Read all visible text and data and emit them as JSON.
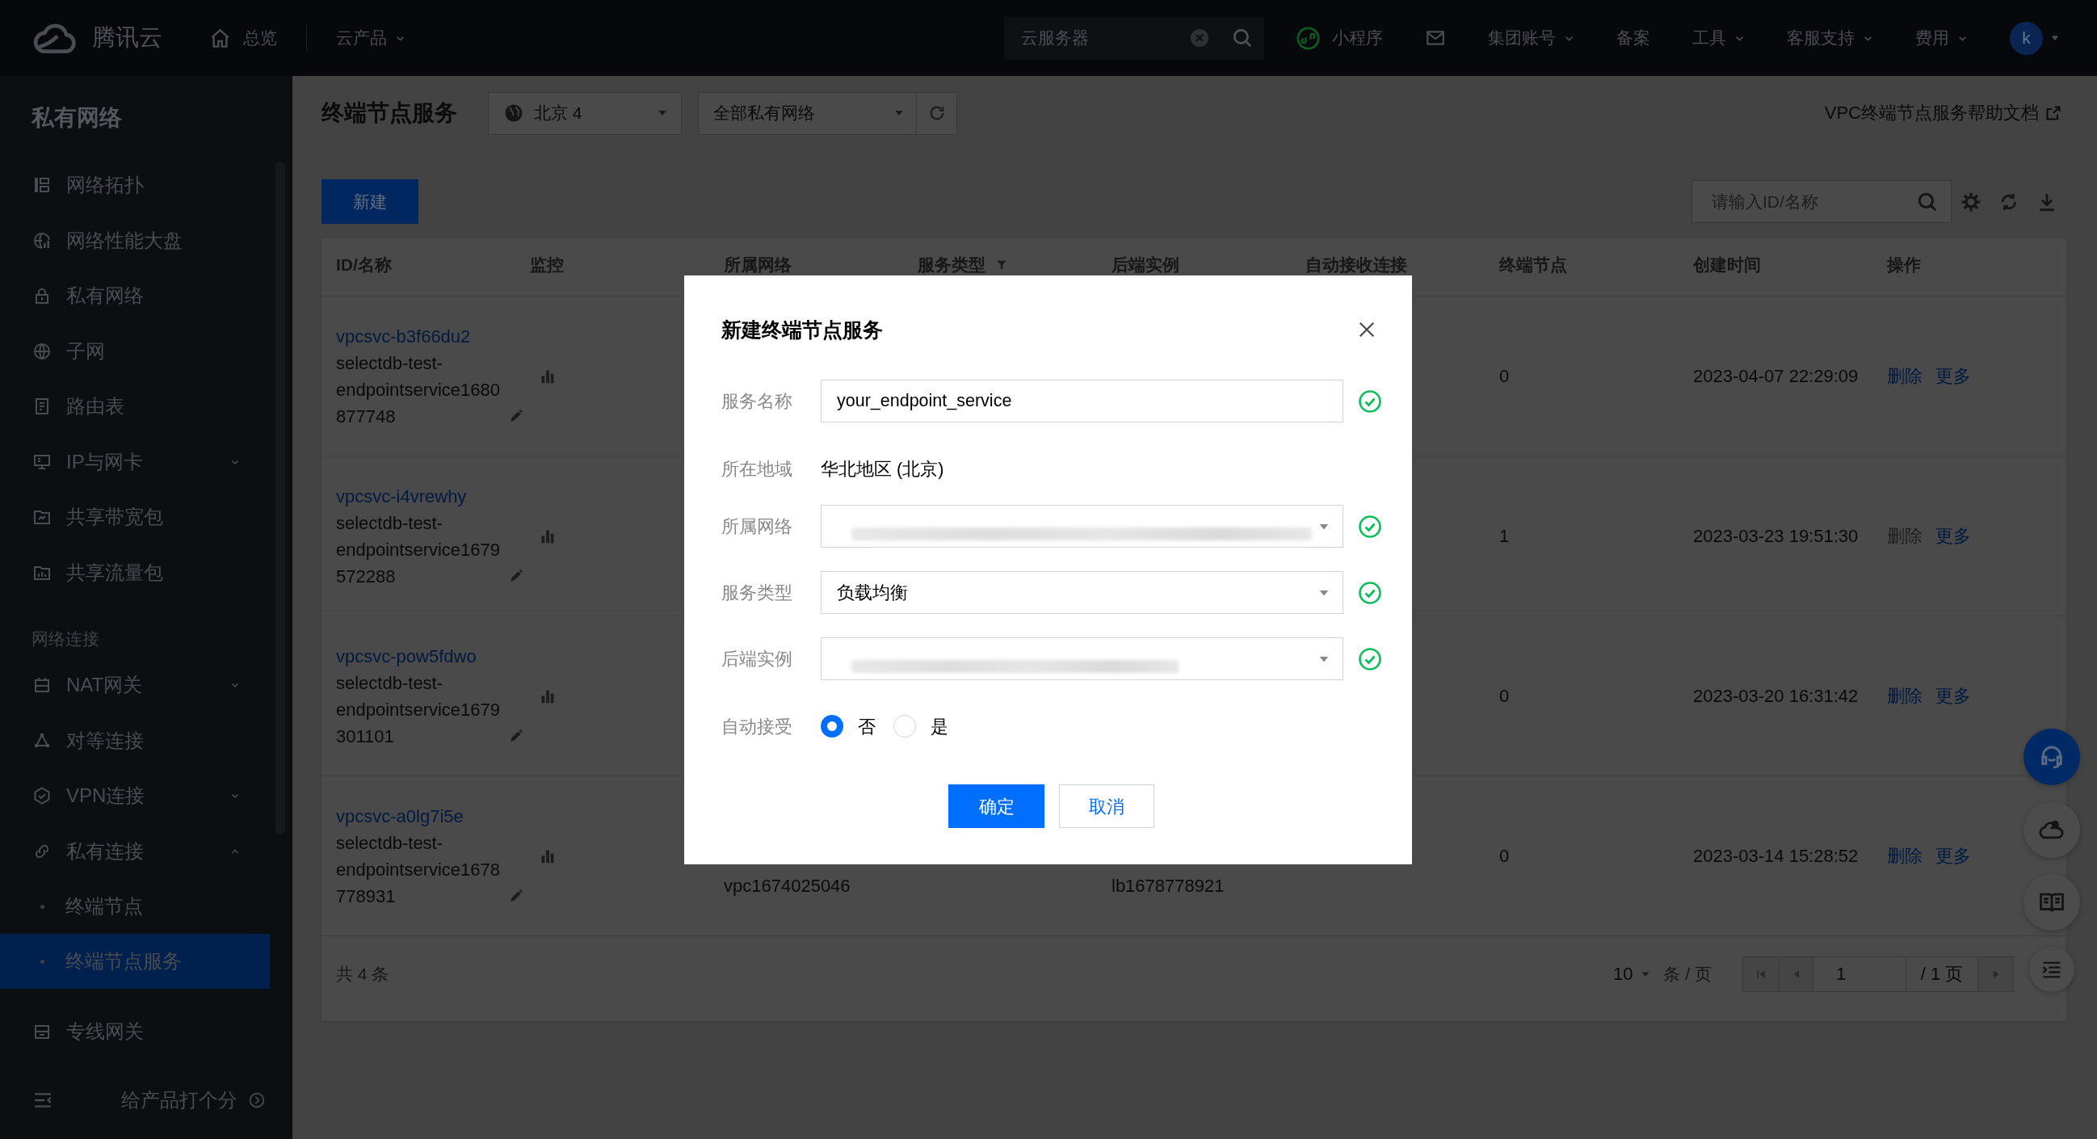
{
  "top_bar": {
    "logo": "腾讯云",
    "nav": [
      {
        "kind": "home",
        "label": "总览"
      },
      {
        "kind": "menu",
        "label": "云产品"
      }
    ],
    "search": {
      "placeholder": "云服务器"
    },
    "links": [
      {
        "kind": "mini_program",
        "label": "小程序"
      },
      {
        "kind": "mail"
      },
      {
        "kind": "menu",
        "label": "集团账号"
      },
      {
        "kind": "link",
        "label": "备案"
      },
      {
        "kind": "menu",
        "label": "工具"
      },
      {
        "kind": "menu",
        "label": "客服支持"
      },
      {
        "kind": "menu",
        "label": "费用"
      }
    ],
    "avatar": {
      "initial": "k"
    }
  },
  "sidebar": {
    "title": "私有网络",
    "sections": [
      {
        "items": [
          {
            "kind": "page",
            "label": "网络拓扑",
            "selected": false
          },
          {
            "kind": "page",
            "label": "网络性能大盘",
            "selected": false
          },
          {
            "kind": "page",
            "label": "私有网络",
            "selected": false
          },
          {
            "kind": "page",
            "label": "子网",
            "selected": false
          },
          {
            "kind": "page",
            "label": "路由表",
            "selected": false
          },
          {
            "kind": "group",
            "label": "IP与网卡",
            "selected": false,
            "expanded": false
          },
          {
            "kind": "page",
            "label": "共享带宽包",
            "selected": false
          },
          {
            "kind": "page",
            "label": "共享流量包",
            "selected": false
          }
        ]
      },
      {
        "heading": "网络连接",
        "items": [
          {
            "kind": "group",
            "label": "NAT网关",
            "selected": false,
            "expanded": false
          },
          {
            "kind": "page",
            "label": "对等连接",
            "selected": false
          },
          {
            "kind": "group",
            "label": "VPN连接",
            "selected": false,
            "expanded": false
          },
          {
            "kind": "group",
            "label": "私有连接",
            "selected": false,
            "expanded": true,
            "children": [
              {
                "label": "终端节点",
                "selected": false
              },
              {
                "label": "终端节点服务",
                "selected": true
              }
            ]
          },
          {
            "kind": "page",
            "label": "专线网关",
            "selected": false
          }
        ]
      }
    ],
    "footer": {
      "label": "给产品打个分"
    }
  },
  "page_header": {
    "title": "终端节点服务",
    "region": {
      "value": "北京 4"
    },
    "vpc_filter": {
      "value": "全部私有网络"
    },
    "help_link": "VPC终端节点服务帮助文档"
  },
  "toolbar": {
    "new_button": "新建",
    "search": {
      "placeholder": "请输入ID/名称"
    }
  },
  "table": {
    "columns": [
      {
        "label": "ID/名称",
        "filterable": false
      },
      {
        "label": "监控",
        "filterable": false
      },
      {
        "label": "所属网络",
        "filterable": false
      },
      {
        "label": "服务类型",
        "filterable": true
      },
      {
        "label": "后端实例",
        "filterable": false
      },
      {
        "label": "自动接收连接",
        "filterable": false
      },
      {
        "label": "终端节点",
        "filterable": false
      },
      {
        "label": "创建时间",
        "filterable": false
      },
      {
        "label": "操作",
        "filterable": false
      }
    ],
    "rows": [
      {
        "id": "vpcsvc-b3f66du2",
        "name": "selectdb-test-endpointservice1680877748",
        "endpoints": "0",
        "created": "2023-04-07 22:29:09",
        "actions": [
          {
            "label": "删除",
            "disabled": false
          },
          {
            "label": "更多",
            "disabled": false
          }
        ]
      },
      {
        "id": "vpcsvc-i4vrewhy",
        "name": "selectdb-test-endpointservice1679572288",
        "endpoints": "1",
        "created": "2023-03-23 19:51:30",
        "actions": [
          {
            "label": "删除",
            "disabled": true
          },
          {
            "label": "更多",
            "disabled": false
          }
        ]
      },
      {
        "id": "vpcsvc-pow5fdwo",
        "name": "selectdb-test-endpointservice1679301101",
        "endpoints": "0",
        "created": "2023-03-20 16:31:42",
        "actions": [
          {
            "label": "删除",
            "disabled": false
          },
          {
            "label": "更多",
            "disabled": false
          }
        ]
      },
      {
        "id": "vpcsvc-a0lg7i5e",
        "name": "selectdb-test-endpointservice1678778931",
        "network": "vpc1674025046",
        "backend": "lb1678778921",
        "endpoints": "0",
        "created": "2023-03-14 15:28:52",
        "actions": [
          {
            "label": "删除",
            "disabled": false
          },
          {
            "label": "更多",
            "disabled": false
          }
        ]
      }
    ],
    "footer": {
      "total": "共 4 条",
      "page_size": "10",
      "page_size_unit": "条 / 页",
      "page": "1",
      "page_count": "/ 1 页"
    }
  },
  "dialog": {
    "title": "新建终端节点服务",
    "fields": [
      {
        "kind": "input",
        "label": "服务名称",
        "value": "your_endpoint_service",
        "blurred": false,
        "validated": true
      },
      {
        "kind": "text",
        "label": "所在地域",
        "value": "华北地区 (北京)",
        "validated": false
      },
      {
        "kind": "select",
        "label": "所属网络",
        "blurred": true,
        "validated": true
      },
      {
        "kind": "select",
        "label": "服务类型",
        "value": "负载均衡",
        "blurred": false,
        "validated": true
      },
      {
        "kind": "select",
        "label": "后端实例",
        "blurred": true,
        "validated": true
      },
      {
        "kind": "radio",
        "label": "自动接受",
        "validated": false,
        "options": [
          {
            "label": "否",
            "selected": true
          },
          {
            "label": "是",
            "selected": false
          }
        ]
      }
    ],
    "buttons": [
      {
        "kind": "primary",
        "label": "确定"
      },
      {
        "kind": "secondary",
        "label": "取消"
      }
    ]
  }
}
